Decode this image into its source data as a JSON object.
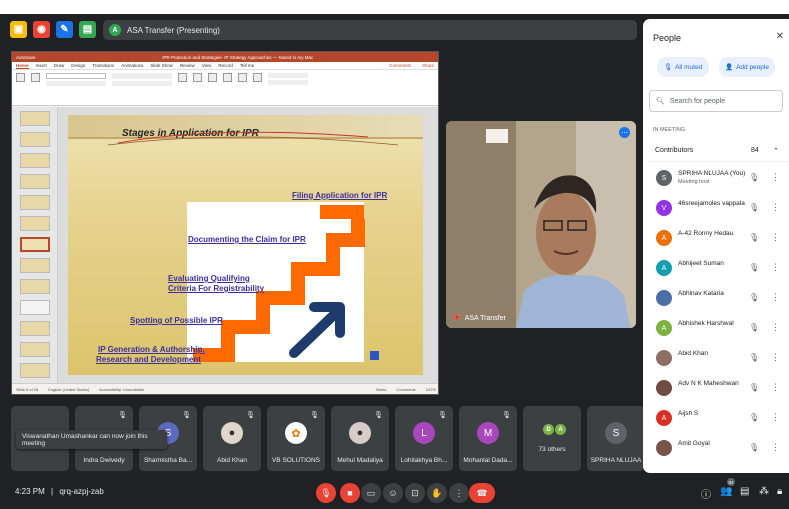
{
  "top_bar": {
    "presenter_initial": "A",
    "presenting_label": "ASA Transfer (Presenting)"
  },
  "powerpoint": {
    "title": "IPR Protection and Strategies- IP Strategy Approaches — Saved to my Mac",
    "autosave": "AutoSave",
    "tabs": [
      "Home",
      "Insert",
      "Draw",
      "Design",
      "Transitions",
      "Animations",
      "Slide Show",
      "Review",
      "View",
      "Record",
      "Tell me"
    ],
    "comments": "Comments",
    "share": "Share",
    "status_left": "Slide 8 of 28",
    "status_lang": "English (United States)",
    "status_access": "Accessibility: Unavailable",
    "notes": "Notes",
    "comments_status": "Comments",
    "zoom": "102%",
    "slide": {
      "title": "Stages in Application for IPR",
      "steps": [
        "Filing Application for IPR",
        "Documenting  the Claim for IPR",
        "Evaluating Qualifying",
        "Criteria For Registrability",
        "Spotting of Possible IPR",
        "IP Generation & Authorship,",
        "Research and Development"
      ]
    }
  },
  "speaker": {
    "name": "ASA Transfer"
  },
  "tiles": [
    {
      "name": "",
      "initial": ""
    },
    {
      "name": "Indra Dwivedy",
      "initial": ""
    },
    {
      "name": "Sharmistha Ba...",
      "initial": "S"
    },
    {
      "name": "Abid Khan",
      "initial": ""
    },
    {
      "name": "VB SOLUTIONS",
      "initial": ""
    },
    {
      "name": "Mehul Madaliya",
      "initial": ""
    },
    {
      "name": "Lohitakhya Bh...",
      "initial": "L"
    },
    {
      "name": "Mohanlal Dada...",
      "initial": "M"
    },
    {
      "name": "73 others",
      "initial": ""
    },
    {
      "name": "SPRIHA NLUJAA",
      "initial": "S"
    }
  ],
  "others_avatars": [
    "D",
    "A"
  ],
  "toast": "Viswanathan Umashankar can now join this meeting",
  "bottom_bar": {
    "time": "4:23 PM",
    "separator": "|",
    "meeting_code": "qrq-azpj-zab",
    "people_count": "84"
  },
  "people_panel": {
    "title": "People",
    "all_muted": "All muted",
    "add_people": "Add people",
    "search_placeholder": "Search for people",
    "section_label": "IN MEETING",
    "contributors_label": "Contributors",
    "contributors_count": "84",
    "participants": [
      {
        "name": "SPRIHA NLUJAA (You)",
        "role": "Meeting host",
        "initial": "S",
        "color": "#5f6368"
      },
      {
        "name": "46sreejamoles vappala",
        "role": "",
        "initial": "V",
        "color": "#9334e6"
      },
      {
        "name": "A-42 Ronny Hedau",
        "role": "",
        "initial": "A",
        "color": "#e8710a"
      },
      {
        "name": "Abhijeet Suman",
        "role": "",
        "initial": "A",
        "color": "#129eaf"
      },
      {
        "name": "Abhinav Kataria",
        "role": "",
        "initial": "",
        "color": "#4a6fa5"
      },
      {
        "name": "Abhishek Harshwal",
        "role": "",
        "initial": "A",
        "color": "#7cb342"
      },
      {
        "name": "Abid Khan",
        "role": "",
        "initial": "",
        "color": "#8d6e63"
      },
      {
        "name": "Adv N K Maheshwari",
        "role": "",
        "initial": "",
        "color": "#6d4c41"
      },
      {
        "name": "Aijsh S",
        "role": "",
        "initial": "A",
        "color": "#d93025"
      },
      {
        "name": "Amit Goyal",
        "role": "",
        "initial": "",
        "color": "#795548"
      }
    ]
  },
  "icons": [
    "app-icon-1",
    "app-icon-2",
    "app-icon-3",
    "app-icon-4",
    "mic-off-icon",
    "kebab-menu-icon",
    "search-icon",
    "close-icon",
    "chevron-up-icon",
    "pin-icon",
    "info-icon",
    "people-icon",
    "chat-icon",
    "activities-icon",
    "lock-icon",
    "end-call-icon"
  ]
}
